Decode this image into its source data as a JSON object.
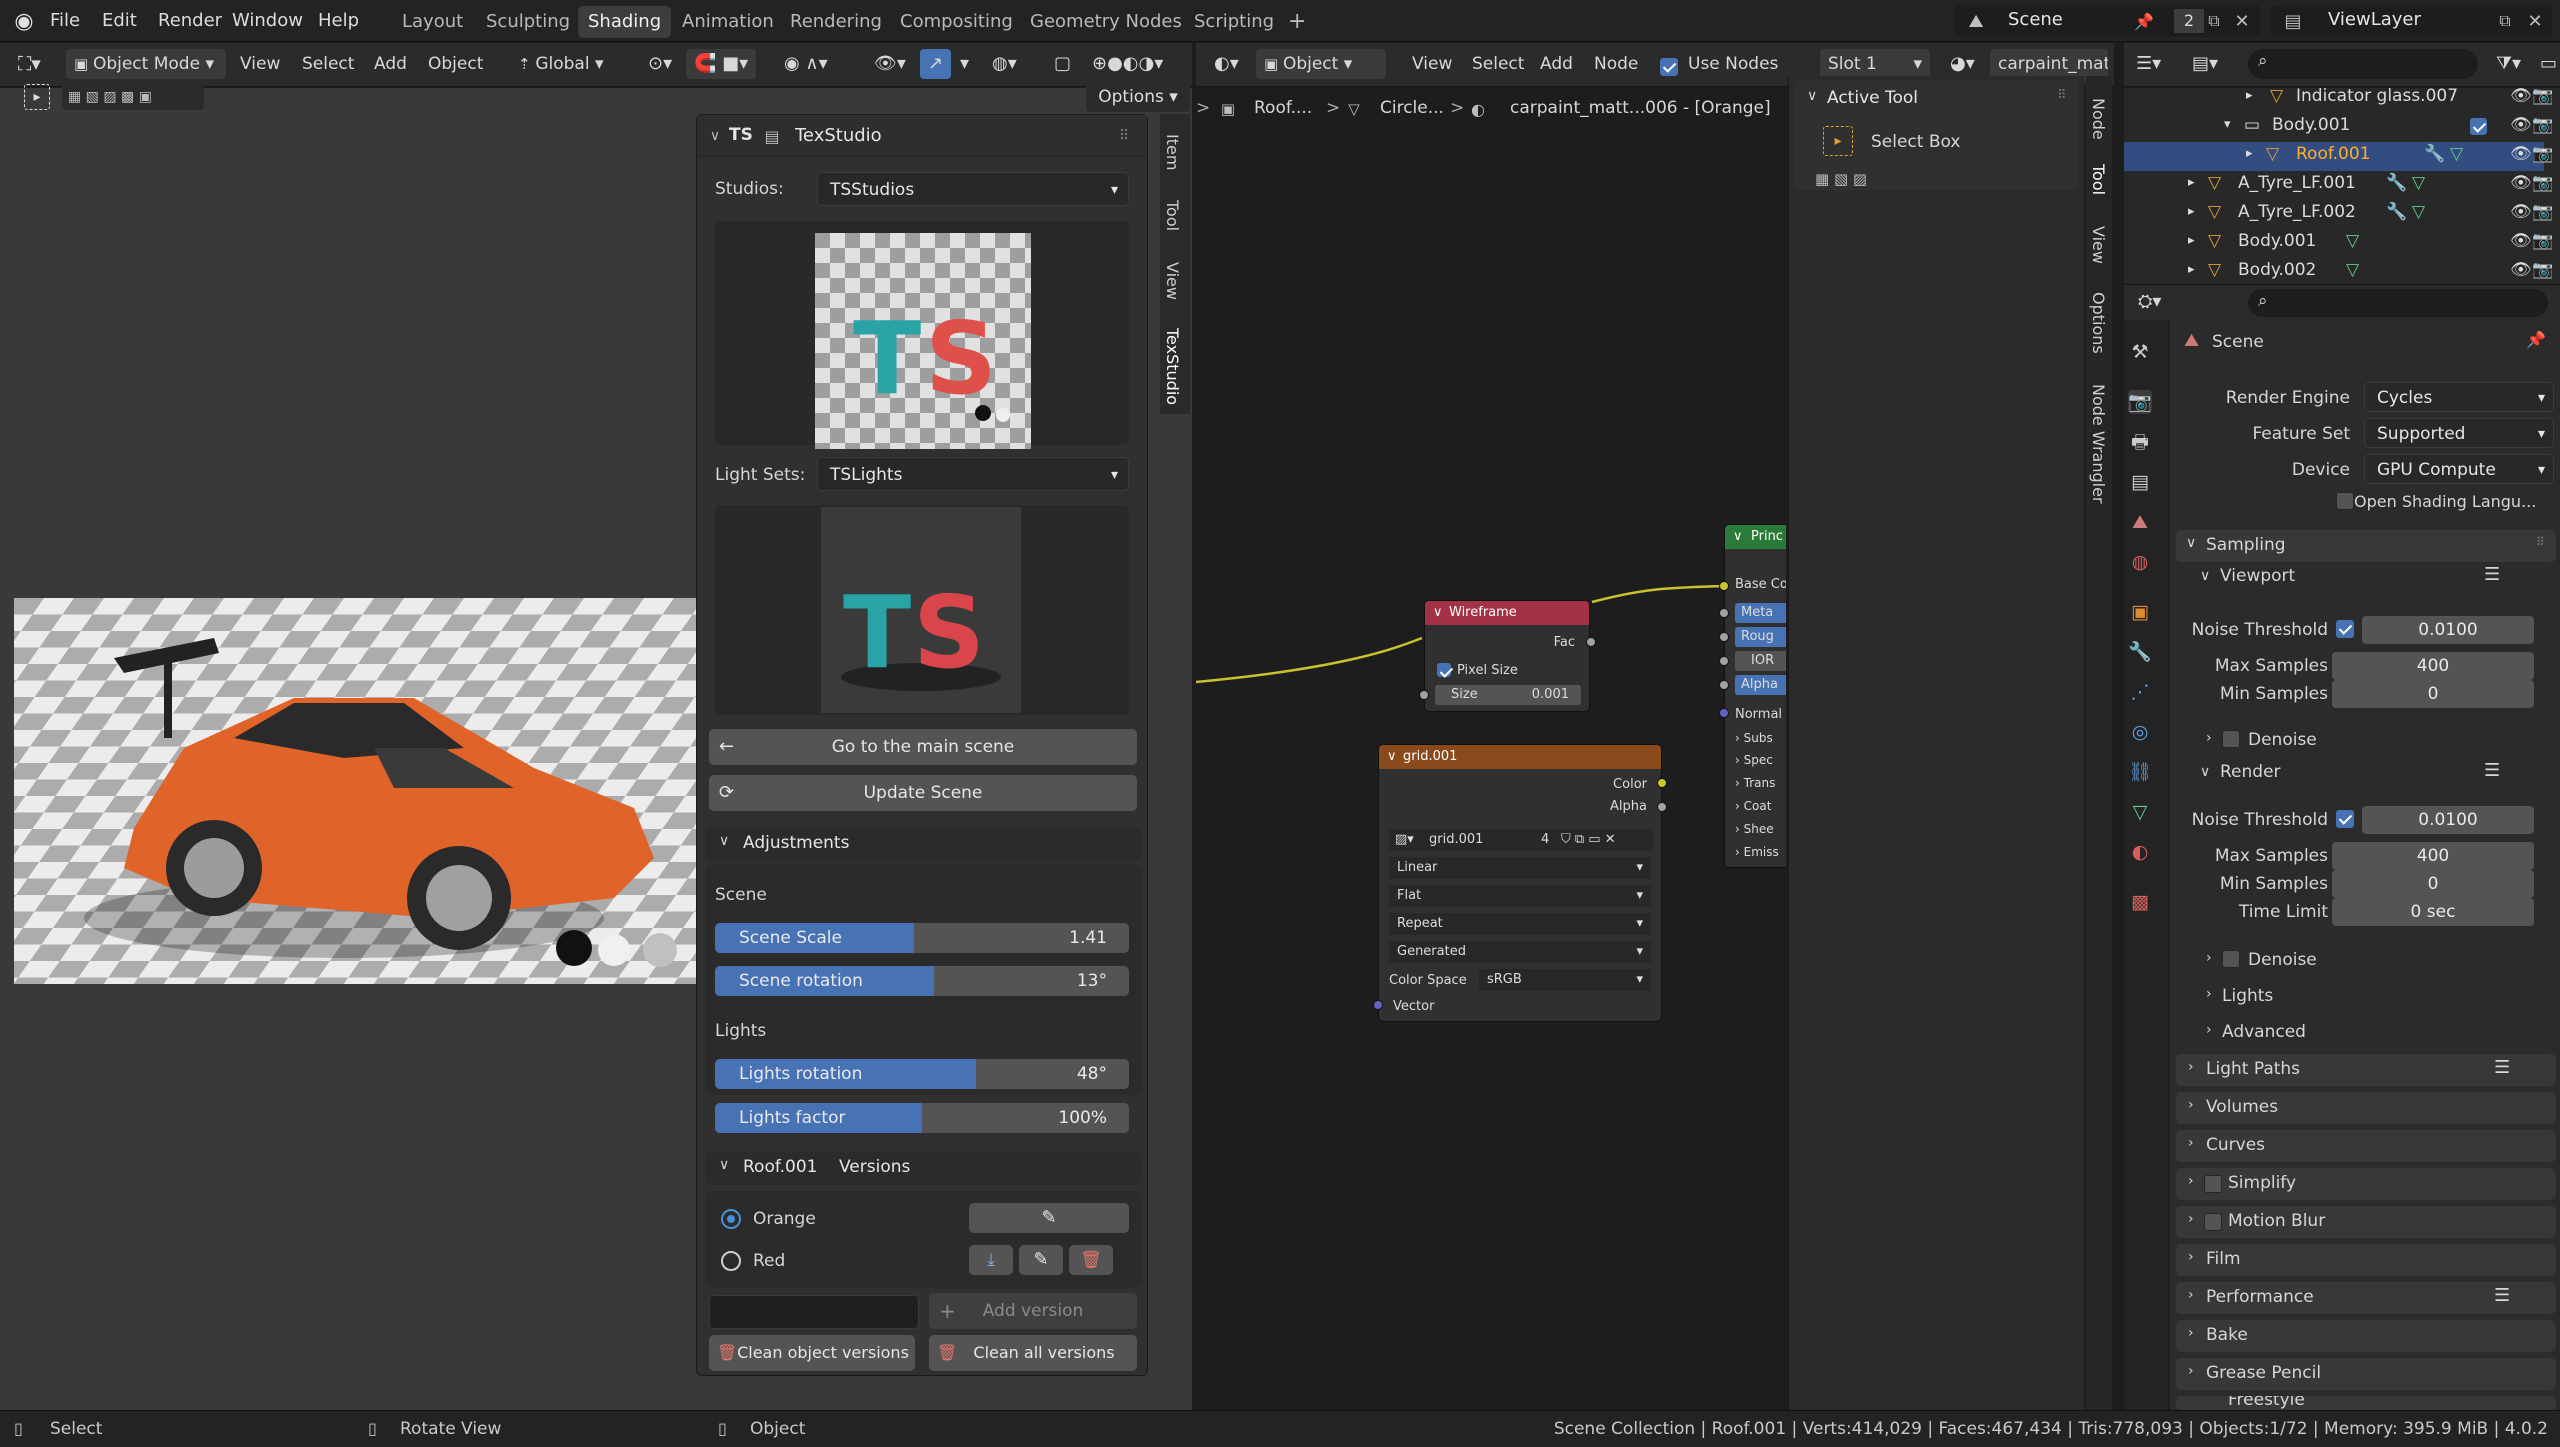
{
  "menu": {
    "file": "File",
    "edit": "Edit",
    "render": "Render",
    "window": "Window",
    "help": "Help"
  },
  "workspaces": [
    "Layout",
    "Sculpting",
    "Shading",
    "Animation",
    "Rendering",
    "Compositing",
    "Geometry Nodes",
    "Scripting"
  ],
  "workspace_add": "+",
  "topright": {
    "scene": "Scene",
    "users": "2",
    "viewlayer": "ViewLayer"
  },
  "viewport_header": {
    "mode": "Object Mode",
    "view": "View",
    "select": "Select",
    "add": "Add",
    "object": "Object",
    "orientation": "Global",
    "options": "Options"
  },
  "node_header": {
    "type": "Object",
    "view": "View",
    "select": "Select",
    "add": "Add",
    "node": "Node",
    "use_nodes": "Use Nodes",
    "slot": "Slot 1",
    "material": "carpaint_matt"
  },
  "breadcrumb": {
    "obj": "Roof....",
    "mesh": "Circle...",
    "mat": "carpaint_matt...006 - [Orange]",
    "sep": ">"
  },
  "texstudio": {
    "title": "TexStudio",
    "logo": "TS",
    "studios_label": "Studios:",
    "studios_value": "TSStudios",
    "lightsets_label": "Light Sets:",
    "lightsets_value": "TSLights",
    "goto_main": "Go to the main scene",
    "update_scene": "Update Scene",
    "adjustments": "Adjustments",
    "scene_section": "Scene",
    "scene_scale_label": "Scene Scale",
    "scene_scale_value": "1.41",
    "scene_scale_fill": 0.48,
    "scene_rotation_label": "Scene rotation",
    "scene_rotation_value": "13°",
    "scene_rotation_fill": 0.53,
    "lights_section": "Lights",
    "lights_rotation_label": "Lights rotation",
    "lights_rotation_value": "48°",
    "lights_rotation_fill": 0.63,
    "lights_factor_label": "Lights factor",
    "lights_factor_value": "100%",
    "lights_factor_fill": 0.5,
    "versions_obj": "Roof.001",
    "versions_label": "Versions",
    "version_orange": "Orange",
    "version_red": "Red",
    "add_version": "Add version",
    "clean_object": "Clean object versions",
    "clean_all": "Clean all versions",
    "tabs": [
      "Item",
      "Tool",
      "View",
      "TexStudio"
    ]
  },
  "node_tabs": [
    "Node",
    "Tool",
    "View",
    "Options",
    "Node Wrangler"
  ],
  "active_tool": {
    "title": "Active Tool",
    "item": "Select Box"
  },
  "nodes": {
    "wireframe": {
      "title": "Wireframe",
      "fac": "Fac",
      "pixel_size": "Pixel Size",
      "size_label": "Size",
      "size_value": "0.001"
    },
    "grid": {
      "title": "grid.001",
      "color": "Color",
      "alpha": "Alpha",
      "image": "grid.001",
      "users": "4",
      "interp": "Linear",
      "proj": "Flat",
      "ext": "Repeat",
      "source": "Generated",
      "cs_label": "Color Space",
      "cs_value": "sRGB",
      "vector": "Vector"
    },
    "principled": {
      "title": "Princ",
      "base": "Base Co",
      "metal": "Meta",
      "rough": "Roug",
      "ior": "IOR",
      "alpha": "Alpha",
      "normal": "Normal",
      "subs": "Subs",
      "spec": "Spec",
      "trans": "Trans",
      "coat": "Coat",
      "sheen": "Shee",
      "emis": "Emiss"
    }
  },
  "outliner": {
    "items": [
      "Indicator glass.007",
      "Body.001",
      "Roof.001",
      "A_Tyre_LF.001",
      "A_Tyre_LF.002",
      "Body.001",
      "Body.002"
    ]
  },
  "properties": {
    "scene": "Scene",
    "render_engine_label": "Render Engine",
    "render_engine": "Cycles",
    "feature_set_label": "Feature Set",
    "feature_set": "Supported",
    "device_label": "Device",
    "device": "GPU Compute",
    "osl": "Open Shading Langu...",
    "sampling": "Sampling",
    "viewport": "Viewport",
    "noise_threshold": "Noise Threshold",
    "vp_noise": "0.0100",
    "max_samples": "Max Samples",
    "vp_max": "400",
    "min_samples": "Min Samples",
    "vp_min": "0",
    "denoise": "Denoise",
    "render": "Render",
    "r_noise": "0.0100",
    "r_max": "400",
    "r_min": "0",
    "time_limit": "Time Limit",
    "r_time": "0 sec",
    "lights": "Lights",
    "advanced": "Advanced",
    "light_paths": "Light Paths",
    "volumes": "Volumes",
    "curves": "Curves",
    "simplify": "Simplify",
    "motion_blur": "Motion Blur",
    "film": "Film",
    "performance": "Performance",
    "bake": "Bake",
    "grease_pencil": "Grease Pencil",
    "freestyle": "Freestyle"
  },
  "status": {
    "select": "Select",
    "rotate": "Rotate View",
    "object": "Object",
    "info": "Scene Collection | Roof.001 | Verts:414,029 | Faces:467,434 | Tris:778,093 | Objects:1/72 | Memory: 395.9 MiB | 4.0.2"
  }
}
